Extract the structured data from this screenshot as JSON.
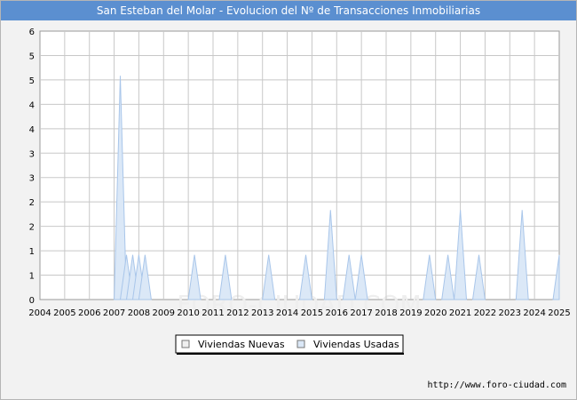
{
  "header": {
    "title": "San Esteban del Molar - Evolucion del Nº de Transacciones Inmobiliarias"
  },
  "source_text": "http://www.foro-ciudad.com",
  "watermark": "FORO-CIUDAD.COM",
  "colors": {
    "title_bg": "#5b8fd0",
    "plot_bg": "#ffffff",
    "grid": "#c8c8c8",
    "usadas_fill": "#dbe8f7",
    "usadas_line": "#a9c6ea",
    "nuevas_fill": "#f0f0f0"
  },
  "chart_data": {
    "type": "area",
    "title": "San Esteban del Molar - Evolucion del Nº de Transacciones Inmobiliarias",
    "xlabel": "",
    "ylabel": "",
    "ylim": [
      0,
      6
    ],
    "y_tick_labels": [
      "0",
      "1",
      "1",
      "2",
      "2",
      "3",
      "3",
      "4",
      "4",
      "5",
      "5",
      "6"
    ],
    "x_tick_labels": [
      "2004",
      "2005",
      "2006",
      "2007",
      "2008",
      "2009",
      "2010",
      "2011",
      "2012",
      "2013",
      "2014",
      "2015",
      "2016",
      "2017",
      "2018",
      "2019",
      "2020",
      "2021",
      "2022",
      "2023",
      "2024",
      "2025"
    ],
    "grid": true,
    "legend_position": "bottom-center",
    "series": [
      {
        "name": "Viviendas Nuevas",
        "x": [],
        "values": []
      },
      {
        "name": "Viviendas Usadas",
        "x": [
          2007.25,
          2007.5,
          2007.75,
          2008.0,
          2008.25,
          2010.25,
          2011.5,
          2013.25,
          2014.75,
          2015.75,
          2016.5,
          2017.0,
          2019.75,
          2020.5,
          2021.0,
          2021.75,
          2023.5,
          2025.0
        ],
        "values": [
          5,
          1,
          1,
          1,
          1,
          1,
          1,
          1,
          1,
          2,
          1,
          1,
          1,
          1,
          2,
          1,
          2,
          1
        ]
      }
    ]
  }
}
